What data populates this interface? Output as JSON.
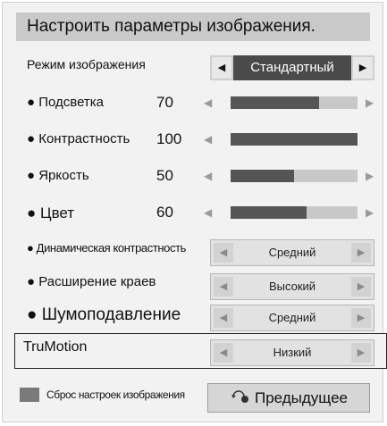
{
  "title": "Настроить параметры изображения.",
  "picture_mode": {
    "label": "Режим изображения",
    "value": "Стандартный"
  },
  "sliders": [
    {
      "label": "● Подсветка",
      "value": "70",
      "level": 70
    },
    {
      "label": "● Контрастность",
      "value": "100",
      "level": 100
    },
    {
      "label": "● Яркость",
      "value": "50",
      "level": 50
    },
    {
      "label": "● Цвет",
      "value": "60",
      "level": 60
    }
  ],
  "options": [
    {
      "label": "● Динамическая контрастность",
      "value": "Средний"
    },
    {
      "label": "● Расширение краев",
      "value": "Высокий"
    },
    {
      "label": "● Шумоподавление",
      "value": "Средний"
    },
    {
      "label": "TruMotion",
      "value": "Низкий"
    }
  ],
  "footer": {
    "reset_label": "Сброс настроек изображения",
    "prev_label": "Предыдущее"
  },
  "icons": {
    "left": "left-arrow-icon",
    "right": "right-arrow-icon",
    "back": "back-arrow-icon"
  }
}
